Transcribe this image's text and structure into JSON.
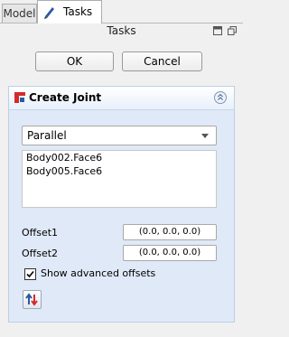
{
  "tabs": {
    "model": "Model",
    "tasks": "Tasks"
  },
  "panel_title": "Tasks",
  "buttons": {
    "ok": "OK",
    "cancel": "Cancel"
  },
  "task": {
    "title": "Create Joint",
    "icon": "create-joint-icon",
    "joint_type": "Parallel",
    "selection": [
      "Body002.Face6",
      "Body005.Face6"
    ],
    "offset1": {
      "label": "Offset1",
      "value": "(0.0, 0.0, 0.0)"
    },
    "offset2": {
      "label": "Offset2",
      "value": "(0.0, 0.0, 0.0)"
    },
    "show_advanced": {
      "label": "Show advanced offsets",
      "checked": true
    }
  },
  "colors": {
    "header_bg": "#dfe9f7",
    "accent_red": "#d42a2a",
    "accent_blue": "#2c5aa0"
  }
}
